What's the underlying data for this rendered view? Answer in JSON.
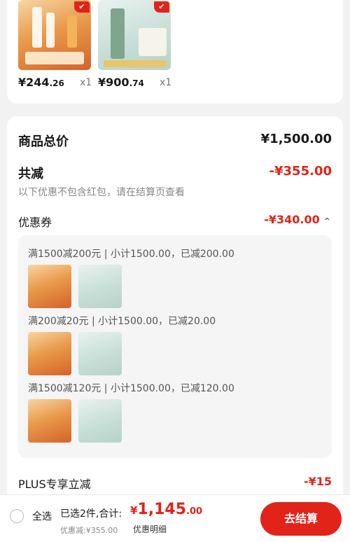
{
  "products": [
    {
      "price_main": "¥244",
      "price_decimal": ".26",
      "qty": "x1",
      "badge": "✔"
    },
    {
      "price_main": "¥900",
      "price_decimal": ".74",
      "qty": "x1",
      "badge": "✔"
    }
  ],
  "summary": {
    "total_label": "商品总价",
    "total_value": "¥1,500.00",
    "reduce_label": "共减",
    "reduce_value": "-¥355.00",
    "note": "以下优惠不包含红包，请在结算页查看",
    "coupon_label": "优惠券",
    "coupon_value": "-¥340.00",
    "caret": "^",
    "rules": [
      "满1500减200元 | 小计1500.00，已减200.00",
      "满200减20元 | 小计1500.00，已减20.00",
      "满1500减120元 | 小计1500.00，已减120.00"
    ],
    "plus_label": "PLUS专享立减",
    "plus_value": "-¥15"
  },
  "bottom": {
    "select_all": "全选",
    "selected_text": "已选2件,合计:",
    "total_symbol": "¥",
    "total_int": "1,145",
    "total_dec": ".00",
    "discount_sub": "优惠减:¥355.00",
    "detail_link": "优惠明细",
    "checkout": "去结算"
  },
  "colors": {
    "accent": "#e2231a",
    "background": "#f2f2f2"
  }
}
